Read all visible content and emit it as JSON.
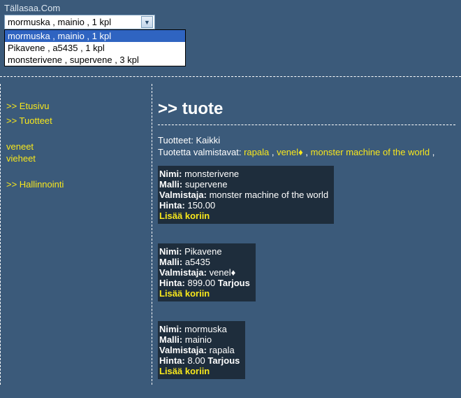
{
  "site_title": "Tällasaa.Com",
  "dropdown": {
    "selected": "mormuska , mainio , 1 kpl",
    "options": [
      "mormuska , mainio , 1 kpl",
      "Pikavene , a5435 , 1 kpl",
      "monsterivene , supervene , 3 kpl"
    ]
  },
  "sidebar": {
    "links": [
      ">> Etusivu",
      ">> Tuotteet"
    ],
    "sublinks": [
      "veneet",
      "vieheet"
    ],
    "admin": ">> Hallinnointi"
  },
  "content": {
    "heading": ">> tuote",
    "category_label": "Tuotteet:",
    "category_value": "Kaikki",
    "manu_label": "Tuotetta valmistavat:",
    "manufacturers": [
      "rapala",
      "venel♦",
      "monster machine of the world"
    ],
    "labels": {
      "name": "Nimi:",
      "model": "Malli:",
      "manufacturer": "Valmistaja:",
      "price": "Hinta:",
      "offer": "Tarjous",
      "add": "Lisää koriin"
    },
    "products": [
      {
        "name": "monsterivene",
        "model": "supervene",
        "manufacturer": "monster machine of the world",
        "price": "150.00",
        "offer": false
      },
      {
        "name": "Pikavene",
        "model": "a5435",
        "manufacturer": "venel♦",
        "price": "899.00",
        "offer": true
      },
      {
        "name": "mormuska",
        "model": "mainio",
        "manufacturer": "rapala",
        "price": "8.00",
        "offer": true
      }
    ]
  }
}
